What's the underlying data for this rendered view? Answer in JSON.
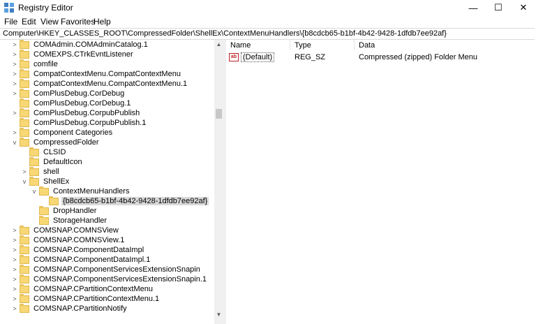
{
  "window": {
    "title": "Registry Editor",
    "minimize_glyph": "—",
    "maximize_glyph": "☐",
    "close_glyph": "✕",
    "icon": "registry-icon"
  },
  "menu": [
    "File",
    "Edit",
    "View",
    "Favorites",
    "Help"
  ],
  "address": "Computer\\HKEY_CLASSES_ROOT\\CompressedFolder\\ShellEx\\ContextMenuHandlers\\{b8cdcb65-b1bf-4b42-9428-1dfdb7ee92af}",
  "tree": [
    {
      "label": "COMAdmin.COMAdminCatalog.1",
      "expander": ">",
      "selected": false
    },
    {
      "label": "COMEXPS.CTrkEvntListener",
      "expander": ">",
      "selected": false
    },
    {
      "label": "comfile",
      "expander": ">",
      "selected": false
    },
    {
      "label": "CompatContextMenu.CompatContextMenu",
      "expander": ">",
      "selected": false
    },
    {
      "label": "CompatContextMenu.CompatContextMenu.1",
      "expander": ">",
      "selected": false
    },
    {
      "label": "ComPlusDebug.CorDebug",
      "expander": ">",
      "selected": false
    },
    {
      "label": "ComPlusDebug.CorDebug.1",
      "expander": "",
      "selected": false
    },
    {
      "label": "ComPlusDebug.CorpubPublish",
      "expander": ">",
      "selected": false
    },
    {
      "label": "ComPlusDebug.CorpubPublish.1",
      "expander": "",
      "selected": false
    },
    {
      "label": "Component Categories",
      "expander": ">",
      "selected": false
    },
    {
      "label": "CompressedFolder",
      "expander": "v",
      "selected": false
    },
    {
      "label": "CLSID",
      "expander": "",
      "selected": false
    },
    {
      "label": "DefaultIcon",
      "expander": "",
      "selected": false
    },
    {
      "label": "shell",
      "expander": ">",
      "selected": false
    },
    {
      "label": "ShellEx",
      "expander": "v",
      "selected": false
    },
    {
      "label": "ContextMenuHandlers",
      "expander": "v",
      "selected": false
    },
    {
      "label": "{b8cdcb65-b1bf-4b42-9428-1dfdb7ee92af}",
      "expander": "",
      "selected": true
    },
    {
      "label": "DropHandler",
      "expander": "",
      "selected": false
    },
    {
      "label": "StorageHandler",
      "expander": "",
      "selected": false
    },
    {
      "label": "COMSNAP.COMNSView",
      "expander": ">",
      "selected": false
    },
    {
      "label": "COMSNAP.COMNSView.1",
      "expander": ">",
      "selected": false
    },
    {
      "label": "COMSNAP.ComponentDataImpl",
      "expander": ">",
      "selected": false
    },
    {
      "label": "COMSNAP.ComponentDataImpl.1",
      "expander": ">",
      "selected": false
    },
    {
      "label": "COMSNAP.ComponentServicesExtensionSnapin",
      "expander": ">",
      "selected": false
    },
    {
      "label": "COMSNAP.ComponentServicesExtensionSnapin.1",
      "expander": ">",
      "selected": false
    },
    {
      "label": "COMSNAP.CPartitionContextMenu",
      "expander": ">",
      "selected": false
    },
    {
      "label": "COMSNAP.CPartitionContextMenu.1",
      "expander": ">",
      "selected": false
    },
    {
      "label": "COMSNAP.CPartitionNotify",
      "expander": ">",
      "selected": false
    }
  ],
  "list": {
    "headers": {
      "name": "Name",
      "type": "Type",
      "data": "Data"
    },
    "rows": [
      {
        "icon_label": "ab",
        "name": "(Default)",
        "type": "REG_SZ",
        "data": "Compressed (zipped) Folder Menu"
      }
    ]
  },
  "scrollbar": {
    "up_glyph": "▲",
    "down_glyph": "▼"
  },
  "colors": {
    "folder": "#f8d775",
    "selection": "#d9d9d9",
    "string_icon": "#bb2222"
  }
}
